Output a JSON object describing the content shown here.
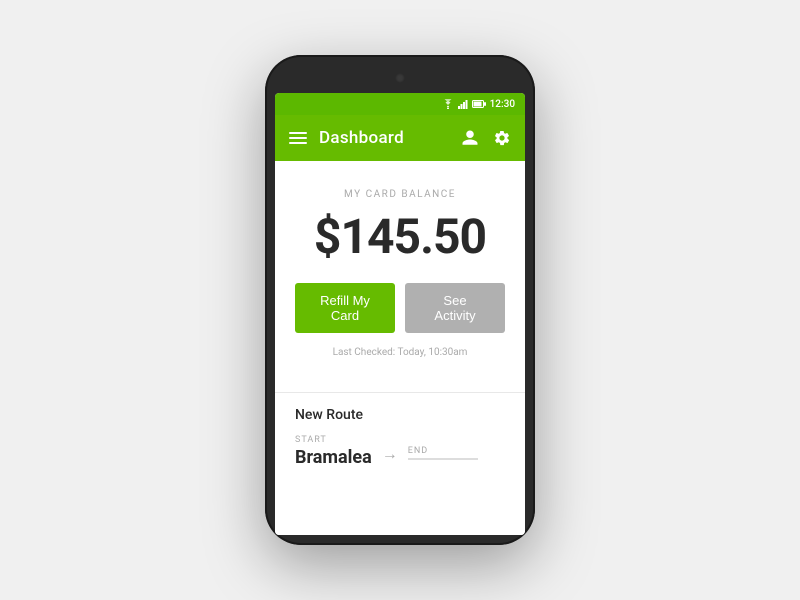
{
  "phone": {
    "status_bar": {
      "time": "12:30"
    },
    "app_bar": {
      "title": "Dashboard",
      "menu_icon": "menu",
      "account_icon": "account",
      "settings_icon": "settings"
    },
    "balance_section": {
      "label": "MY CARD BALANCE",
      "amount": "$145.50",
      "refill_button": "Refill My Card",
      "activity_button": "See Activity",
      "last_checked": "Last Checked: Today, 10:30am"
    },
    "route_section": {
      "title": "New Route",
      "start_label": "START",
      "start_value": "Bramalea",
      "end_label": "END"
    }
  }
}
